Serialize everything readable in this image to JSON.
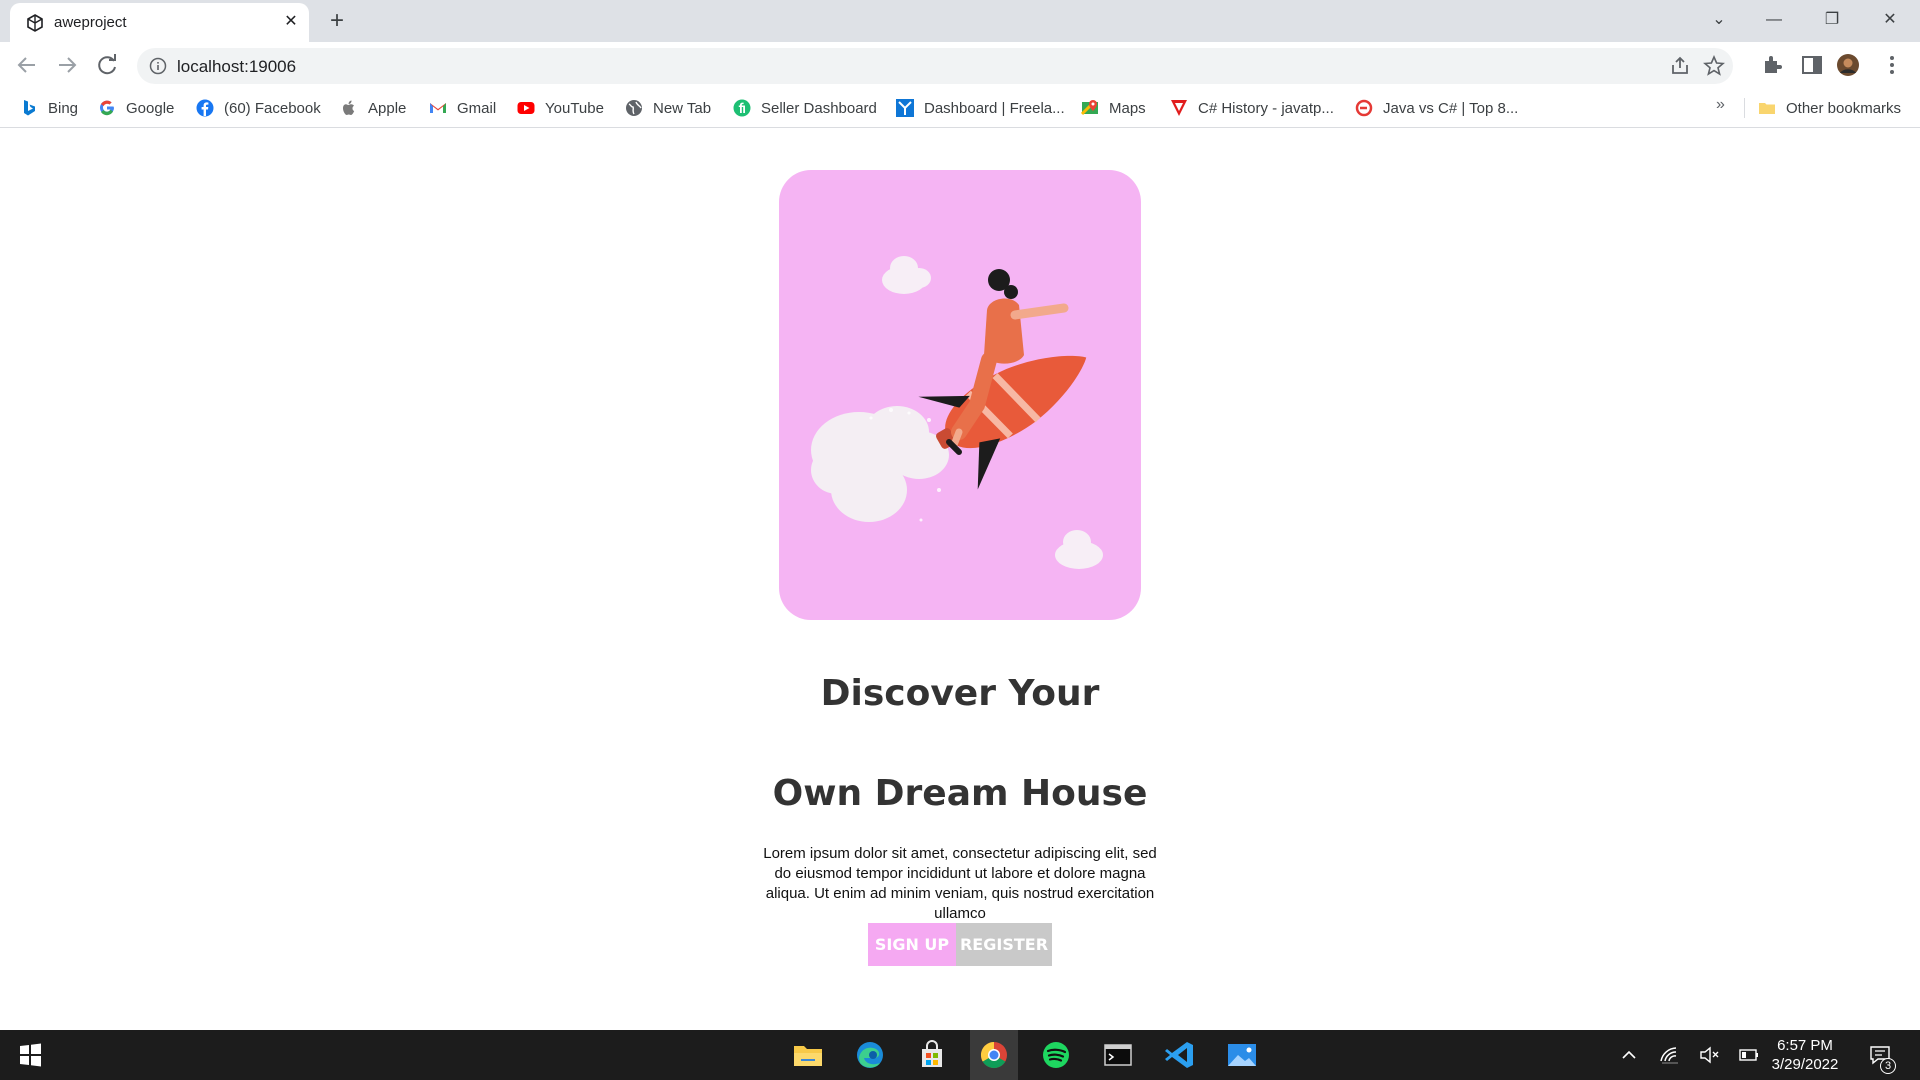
{
  "tab": {
    "title": "aweproject",
    "close": "✕",
    "new_tab": "+"
  },
  "window": {
    "minimize": "—",
    "maximize": "❐",
    "close": "✕",
    "tab_list": "⌄"
  },
  "address": {
    "url": "localhost:19006"
  },
  "bookmarks": [
    {
      "label": "Bing",
      "icon": "bing-icon"
    },
    {
      "label": "Google",
      "icon": "google-icon"
    },
    {
      "label": "(60) Facebook",
      "icon": "facebook-icon"
    },
    {
      "label": "Apple",
      "icon": "apple-icon"
    },
    {
      "label": "Gmail",
      "icon": "gmail-icon"
    },
    {
      "label": "YouTube",
      "icon": "youtube-icon"
    },
    {
      "label": "New Tab",
      "icon": "globe-icon"
    },
    {
      "label": "Seller Dashboard",
      "icon": "fiverr-icon"
    },
    {
      "label": "Dashboard | Freela...",
      "icon": "freelancer-icon"
    },
    {
      "label": "Maps",
      "icon": "maps-icon"
    },
    {
      "label": "C# History - javatp...",
      "icon": "javatpoint-icon"
    },
    {
      "label": "Java vs C# | Top 8...",
      "icon": "educba-icon"
    }
  ],
  "bookmarks_overflow": "»",
  "other_bookmarks": "Other bookmarks",
  "page": {
    "headline_line1": "Discover Your",
    "headline_line2": "Own Dream House",
    "paragraph": "Lorem ipsum dolor sit amet, consectetur adipiscing elit, sed do eiusmod tempor incididunt ut labore et dolore magna aliqua. Ut enim ad minim veniam, quis nostrud exercitation ullamco",
    "signup_label": "SIGN UP",
    "register_label": "REGISTER"
  },
  "taskbar": {
    "time": "6:57 PM",
    "date": "3/29/2022",
    "notification_count": "3",
    "apps": [
      "file-explorer-icon",
      "edge-icon",
      "store-icon",
      "chrome-icon",
      "spotify-icon",
      "terminal-icon",
      "vscode-icon",
      "photos-icon"
    ]
  },
  "colors": {
    "card": "#f5b4f3",
    "signup": "#f5a9f2",
    "register": "#c9c9c9",
    "headline": "#333333"
  }
}
